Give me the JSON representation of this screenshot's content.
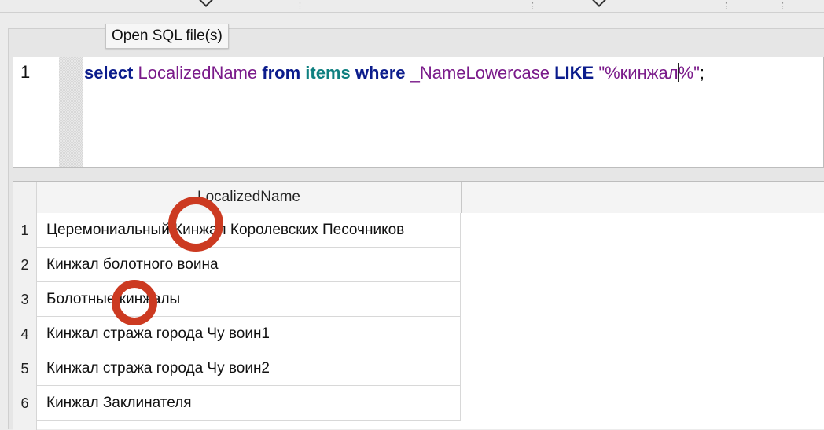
{
  "tooltip": {
    "text": "Open SQL file(s)"
  },
  "editor": {
    "line_number": "1",
    "tokens": {
      "t1": "select",
      "t2": " ",
      "t3": "LocalizedName",
      "t4": " ",
      "t5": "from",
      "t6": " ",
      "t7": "items",
      "t8": " ",
      "t9": "where",
      "t10": " ",
      "t11": "_NameLowercase",
      "t12": " ",
      "t13": "LIKE",
      "t14": " ",
      "t15a": "\"%кинжал",
      "t15b": "%\"",
      "t16": ";"
    }
  },
  "results": {
    "column_header": "LocalizedName",
    "rows": [
      {
        "num": "1",
        "value": "Церемониальный Кинжал Королевских Песочников"
      },
      {
        "num": "2",
        "value": "Кинжал болотного воина"
      },
      {
        "num": "3",
        "value": "Болотные кинжалы"
      },
      {
        "num": "4",
        "value": "Кинжал стража города Чу воин1"
      },
      {
        "num": "5",
        "value": "Кинжал стража города Чу воин2"
      },
      {
        "num": "6",
        "value": "Кинжал Заклинателя"
      }
    ]
  },
  "colors": {
    "keyword": "#0b1c8c",
    "identifier": "#7a1a8a",
    "table": "#0f8080",
    "marker": "#cc3a21"
  }
}
